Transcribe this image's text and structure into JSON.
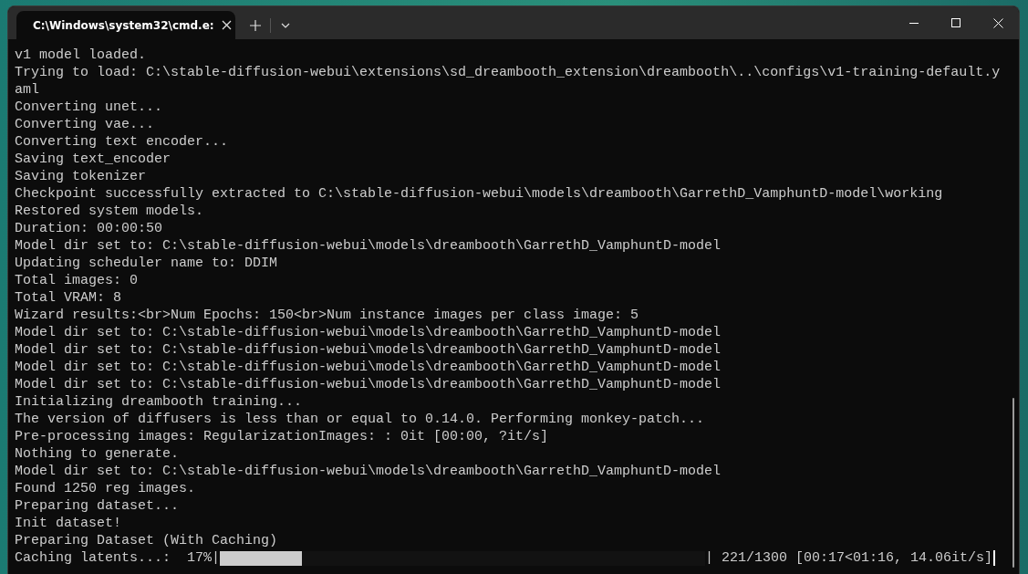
{
  "window": {
    "tab_title": "C:\\Windows\\system32\\cmd.e:"
  },
  "lines": [
    "v1 model loaded.",
    "Trying to load: C:\\stable-diffusion-webui\\extensions\\sd_dreambooth_extension\\dreambooth\\..\\configs\\v1-training-default.y",
    "aml",
    "Converting unet...",
    "Converting vae...",
    "Converting text encoder...",
    "Saving text_encoder",
    "Saving tokenizer",
    "Checkpoint successfully extracted to C:\\stable-diffusion-webui\\models\\dreambooth\\GarrethD_VamphuntD-model\\working",
    "Restored system models.",
    "Duration: 00:00:50",
    "Model dir set to: C:\\stable-diffusion-webui\\models\\dreambooth\\GarrethD_VamphuntD-model",
    "Updating scheduler name to: DDIM",
    "Total images: 0",
    "Total VRAM: 8",
    "Wizard results:<br>Num Epochs: 150<br>Num instance images per class image: 5",
    "Model dir set to: C:\\stable-diffusion-webui\\models\\dreambooth\\GarrethD_VamphuntD-model",
    "Model dir set to: C:\\stable-diffusion-webui\\models\\dreambooth\\GarrethD_VamphuntD-model",
    "Model dir set to: C:\\stable-diffusion-webui\\models\\dreambooth\\GarrethD_VamphuntD-model",
    "Model dir set to: C:\\stable-diffusion-webui\\models\\dreambooth\\GarrethD_VamphuntD-model",
    "Initializing dreambooth training...",
    "The version of diffusers is less than or equal to 0.14.0. Performing monkey-patch...",
    "Pre-processing images: RegularizationImages: : 0it [00:00, ?it/s]",
    "Nothing to generate.",
    "Model dir set to: C:\\stable-diffusion-webui\\models\\dreambooth\\GarrethD_VamphuntD-model",
    "Found 1250 reg images.",
    "Preparing dataset...",
    "Init dataset!",
    "Preparing Dataset (With Caching)"
  ],
  "progress": {
    "label": "Caching latents...:  17%|",
    "level": 0.17,
    "stats": "| 221/1300 [00:17<01:16, 14.06it/s]"
  }
}
